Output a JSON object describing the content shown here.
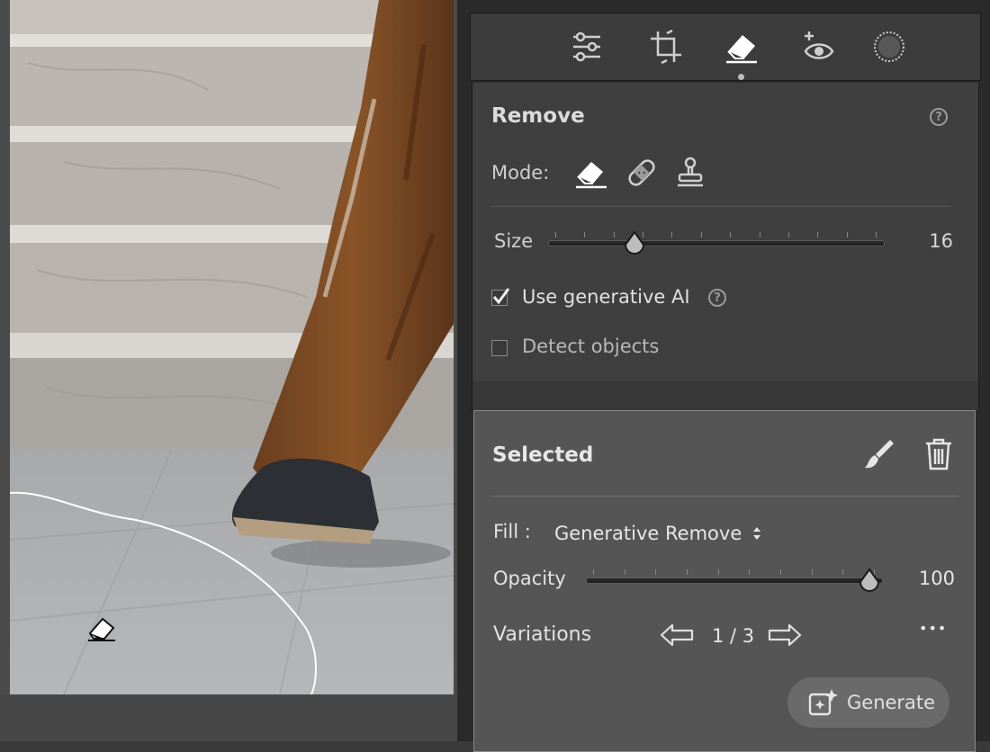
{
  "remove_panel": {
    "title": "Remove",
    "help_glyph": "?",
    "mode_label": "Mode:",
    "mode_icons": [
      "eraser-icon",
      "bandage-icon",
      "clone-stamp-icon"
    ],
    "size_label": "Size",
    "size_value": "16",
    "size_level": 0.17,
    "gen_ai_label": "Use generative AI",
    "gen_ai_checked": true,
    "detect_label": "Detect objects",
    "detect_checked": false
  },
  "selected_panel": {
    "title": "Selected",
    "fill_label": "Fill :",
    "fill_value": "Generative Remove",
    "opacity_label": "Opacity",
    "opacity_value": "100",
    "opacity_level": 1.0,
    "variations_label": "Variations",
    "variations_value": "1 / 3",
    "more_glyph": "•••",
    "generate_label": "Generate"
  },
  "toolbar_icons": [
    "sliders-icon",
    "crop-icon",
    "eraser-icon",
    "redeye-icon",
    "mask-icon"
  ],
  "colors": {
    "panel_bg": "#3f3f3f",
    "selected_bg": "#555555",
    "accent_border": "#8a8a8a"
  }
}
